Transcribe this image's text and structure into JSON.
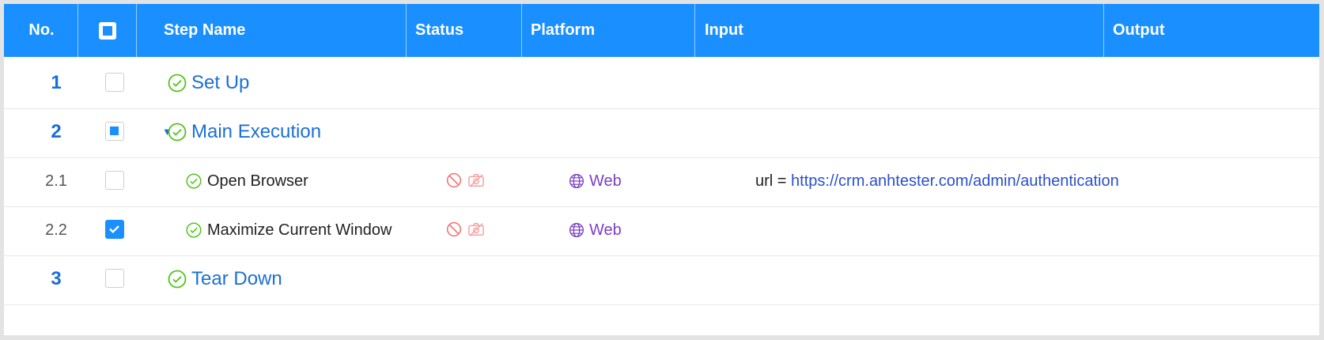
{
  "header": {
    "no": "No.",
    "step_name": "Step Name",
    "status": "Status",
    "platform": "Platform",
    "input": "Input",
    "output": "Output"
  },
  "rows": [
    {
      "no": "1",
      "name": "Set Up",
      "checkbox": "unchecked"
    },
    {
      "no": "2",
      "name": "Main Execution",
      "checkbox": "indeterminate",
      "expanded": true
    },
    {
      "no": "2.1",
      "name": "Open Browser",
      "checkbox": "unchecked",
      "platform": "Web",
      "input_key": "url =",
      "input_value": "https://crm.anhtester.com/admin/authentication"
    },
    {
      "no": "2.2",
      "name": "Maximize Current Window",
      "checkbox": "checked",
      "platform": "Web"
    },
    {
      "no": "3",
      "name": "Tear Down",
      "checkbox": "unchecked"
    }
  ],
  "icons": {
    "header_checkbox": "square-checkbox-icon",
    "step_status": "check-circle-icon",
    "disabled": "ban-icon",
    "screenshot_off": "camera-off-icon",
    "platform": "globe-icon",
    "expand": "caret-down-icon"
  },
  "colors": {
    "header_bg": "#1a8fff",
    "primary_text": "#1a6fd6",
    "success": "#52c41a",
    "danger": "#f56c6c",
    "platform": "#7b3fc4",
    "link": "#2a4fd1"
  }
}
